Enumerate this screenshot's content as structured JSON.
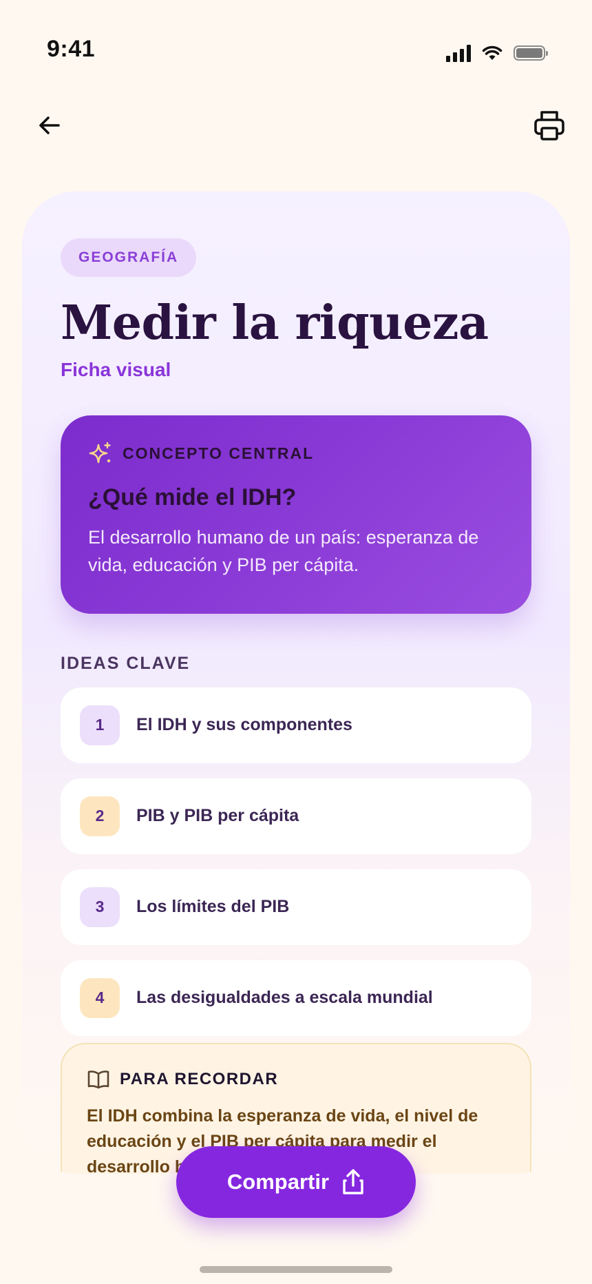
{
  "status": {
    "time": "9:41"
  },
  "card": {
    "subject": "GEOGRAFÍA",
    "title": "Medir la riqueza",
    "subtitle": "Ficha visual",
    "concept": {
      "label": "CONCEPTO CENTRAL",
      "question": "¿Qué mide el IDH?",
      "answer": "El desarrollo humano de un país: esperanza de vida, educación y PIB per cápita."
    },
    "ideas_label": "IDEAS CLAVE",
    "ideas": [
      {
        "num": "1",
        "text": "El IDH y sus componentes"
      },
      {
        "num": "2",
        "text": "PIB y PIB per cápita"
      },
      {
        "num": "3",
        "text": "Los límites del PIB"
      },
      {
        "num": "4",
        "text": "Las desigualdades a escala mundial"
      }
    ],
    "remember": {
      "label": "PARA RECORDAR",
      "text": "El IDH combina la esperanza de vida, el nivel de educación y el PIB per cápita para medir el desarrollo humano."
    }
  },
  "share": {
    "label": "Compartir"
  },
  "colors": {
    "accent": "#8627e0",
    "concept_bg": "#8a3ad6",
    "remember_bg": "#fff4e4"
  }
}
